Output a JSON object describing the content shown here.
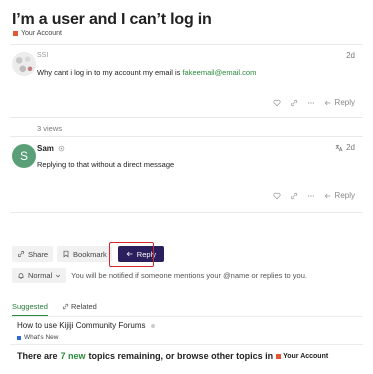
{
  "topic": {
    "title": "I’m a user and I can’t log in",
    "category": "Your Account",
    "category_color": "#e45735"
  },
  "posts": [
    {
      "username": "SSI",
      "date": "2d",
      "body_prefix": "Why cant i log in to my account my email is ",
      "body_link": "fakeemail@email.com",
      "reply_label": "Reply"
    },
    {
      "avatar_letter": "S",
      "username": "Sam",
      "date": "2d",
      "body": "Replying to that without a direct message",
      "reply_label": "Reply"
    }
  ],
  "views": "3 views",
  "actions": {
    "share_label": "Share",
    "bookmark_label": "Bookmark",
    "reply_label": "Reply"
  },
  "notification": {
    "level": "Normal",
    "text": "You will be notified if someone mentions your @name or replies to you."
  },
  "tabs": [
    {
      "label": "Suggested"
    },
    {
      "label": "Related"
    }
  ],
  "suggested": {
    "title": "How to use Kijiji Community Forums",
    "category": "What's New",
    "category_color": "#2f6bd6"
  },
  "remaining": {
    "prefix": "There are",
    "count": "7 new",
    "middle": "topics remaining, or browse other topics in",
    "category": "Your Account"
  }
}
